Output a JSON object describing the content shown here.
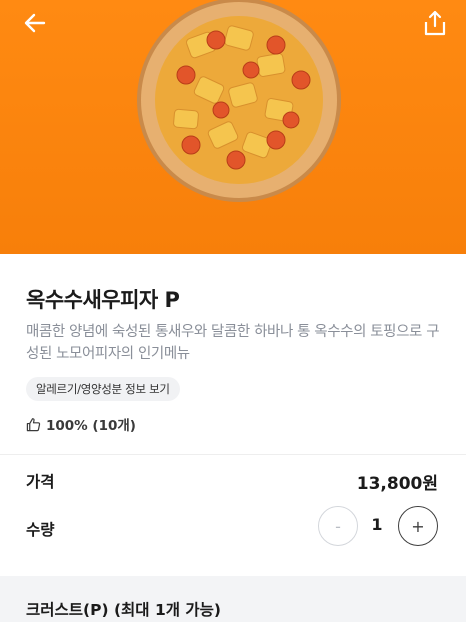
{
  "header": {
    "back_icon": "arrow-left-icon",
    "share_icon": "share-icon",
    "background_color": "#f7820c",
    "image_alt": "옥수수새우피자 이미지"
  },
  "product": {
    "title": "옥수수새우피자 P",
    "description": "매콤한 양념에 숙성된 통새우와 달콤한 하바나 통 옥수수의 토핑으로 구성된 노모어피자의 인기메뉴",
    "allergy_chip": "알레르기/영양성분 정보 보기",
    "like_icon": "thumbs-up-icon",
    "rating": "100% (10개)"
  },
  "order": {
    "price_label": "가격",
    "price_value": "13,800원",
    "qty_label": "수량",
    "qty_value": "1",
    "minus_symbol": "-",
    "plus_symbol": "+"
  },
  "options": {
    "crust_title": "크러스트(P) (최대 1개 가능)"
  }
}
